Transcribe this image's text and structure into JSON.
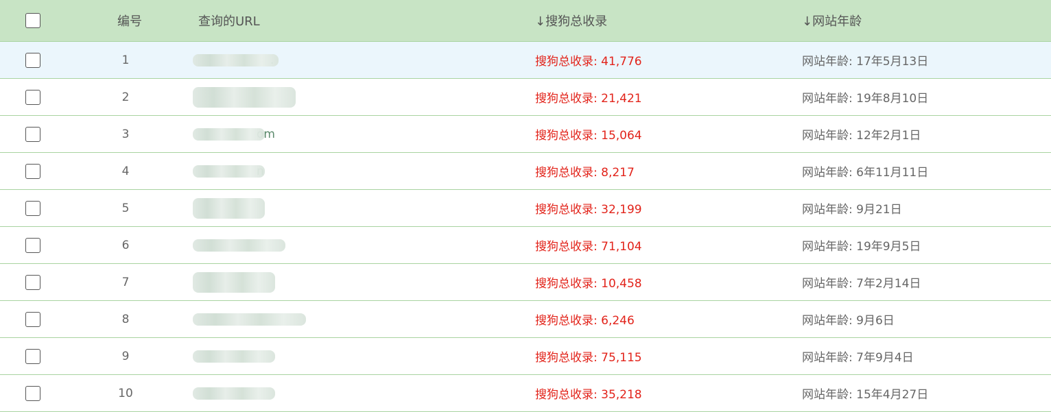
{
  "header": {
    "num": "编号",
    "url": "查询的URL",
    "inclusion": "↓搜狗总收录",
    "age": "↓网站年龄"
  },
  "rows": [
    {
      "num": "1",
      "url_suffix": ".",
      "inclusion": "搜狗总收录: 41,776",
      "age": "网站年龄: 17年5月13日",
      "highlight": true
    },
    {
      "num": "2",
      "url_suffix": "",
      "inclusion": "搜狗总收录: 21,421",
      "age": "网站年龄: 19年8月10日"
    },
    {
      "num": "3",
      "url_suffix": "om",
      "inclusion": "搜狗总收录: 15,064",
      "age": "网站年龄: 12年2月1日"
    },
    {
      "num": "4",
      "url_suffix": "n",
      "inclusion": "搜狗总收录: 8,217",
      "age": "网站年龄: 6年11月11日"
    },
    {
      "num": "5",
      "url_suffix": "",
      "inclusion": "搜狗总收录: 32,199",
      "age": "网站年龄: 9月21日"
    },
    {
      "num": "6",
      "url_suffix": "",
      "inclusion": "搜狗总收录: 71,104",
      "age": "网站年龄: 19年9月5日"
    },
    {
      "num": "7",
      "url_suffix": "",
      "inclusion": "搜狗总收录: 10,458",
      "age": "网站年龄: 7年2月14日"
    },
    {
      "num": "8",
      "url_suffix": "",
      "inclusion": "搜狗总收录: 6,246",
      "age": "网站年龄: 9月6日"
    },
    {
      "num": "9",
      "url_suffix": "",
      "inclusion": "搜狗总收录: 75,115",
      "age": "网站年龄: 7年9月4日"
    },
    {
      "num": "10",
      "url_suffix": "",
      "inclusion": "搜狗总收录: 35,218",
      "age": "网站年龄: 15年4月27日"
    }
  ],
  "colors": {
    "header_bg": "#c8e4c5",
    "row_border": "#a8d3a0",
    "highlight_bg": "#ebf6fc",
    "inclusion_text": "#e2231a",
    "body_text": "#666666"
  }
}
